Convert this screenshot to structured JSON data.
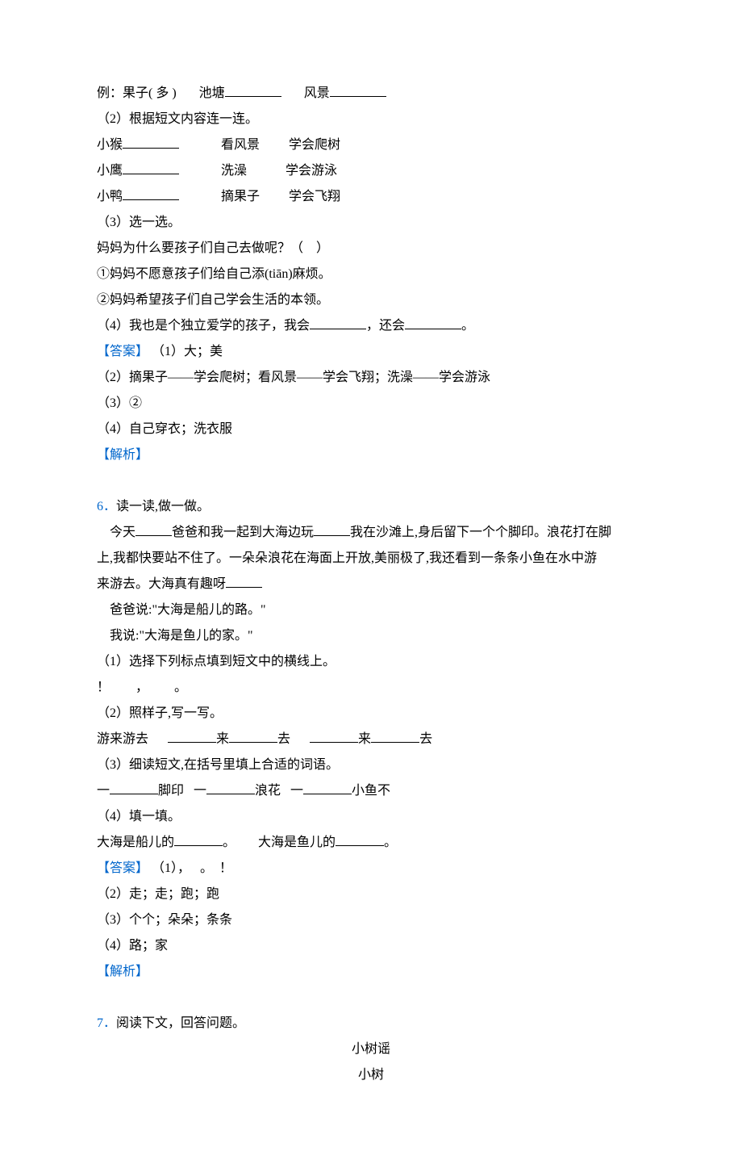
{
  "q5": {
    "l1_a": "例：果子( 多 )",
    "l1_b": "池塘",
    "l1_c": "风景",
    "l2": "（2）根据短文内容连一连。",
    "l3a": "小猴",
    "l3b": "看风景",
    "l3c": "学会爬树",
    "l4a": "小鹰",
    "l4b": "洗澡",
    "l4c": "学会游泳",
    "l5a": "小鸭",
    "l5b": "摘果子",
    "l5c": "学会飞翔",
    "l6": "（3）选一选。",
    "l7": "妈妈为什么要孩子们自己去做呢？（    ）",
    "l8": "①妈妈不愿意孩子们给自己添(tiān)麻烦。",
    "l9": "②妈妈希望孩子们自己学会生活的本领。",
    "l10a": "（4）我也是个独立爱学的孩子，我会",
    "l10b": "，还会",
    "l10c": "。",
    "ans_label": "【答案】",
    "ans1": "（1）大；美",
    "ans2": "（2）摘果子——学会爬树；看风景——学会飞翔；洗澡——学会游泳",
    "ans3": "（3）②",
    "ans4": "（4）自己穿衣；洗衣服",
    "jiexi": "【解析】"
  },
  "q6": {
    "num": "6．",
    "title": "读一读,做一做。",
    "p1a": "今天",
    "p1b": "爸爸和我一起到大海边玩",
    "p1c": "我在沙滩上,身后留下一个个脚印。浪花打在脚",
    "p2": "上,我都快要站不住了。一朵朵浪花在海面上开放,美丽极了,我还看到一条条小鱼在水中游",
    "p3a": "来游去。大海真有趣呀",
    "p4": "爸爸说:\"大海是船儿的路。\"",
    "p5": "我说:\"大海是鱼儿的家。\"",
    "s1": "（1）选择下列标点填到短文中的横线上。",
    "s1_marks": "！        ，        。",
    "s2": "（2）照样子,写一写。",
    "s2_ex_a": "游来游去",
    "s2_ex_b": "来",
    "s2_ex_c": "去",
    "s2_ex_d": "来",
    "s2_ex_e": "去",
    "s3": "（3）细读短文,在括号里填上合适的词语。",
    "s3_a": "一",
    "s3_b": "脚印   一",
    "s3_c": "浪花   一",
    "s3_d": "小鱼不",
    "s4": "（4）填一填。",
    "s4_a": "大海是船儿的",
    "s4_b": "。",
    "s4_c": "大海是鱼儿的",
    "s4_d": "。",
    "ans_label": "【答案】",
    "ans1": "（1），   。  ！",
    "ans2": "（2）走；走；跑；跑",
    "ans3": "（3）个个；朵朵；条条",
    "ans4": "（4）路；家",
    "jiexi": "【解析】"
  },
  "q7": {
    "num": "7．",
    "title": "阅读下文，回答问题。",
    "poem_title": "小树谣",
    "poem_line": "小树"
  }
}
